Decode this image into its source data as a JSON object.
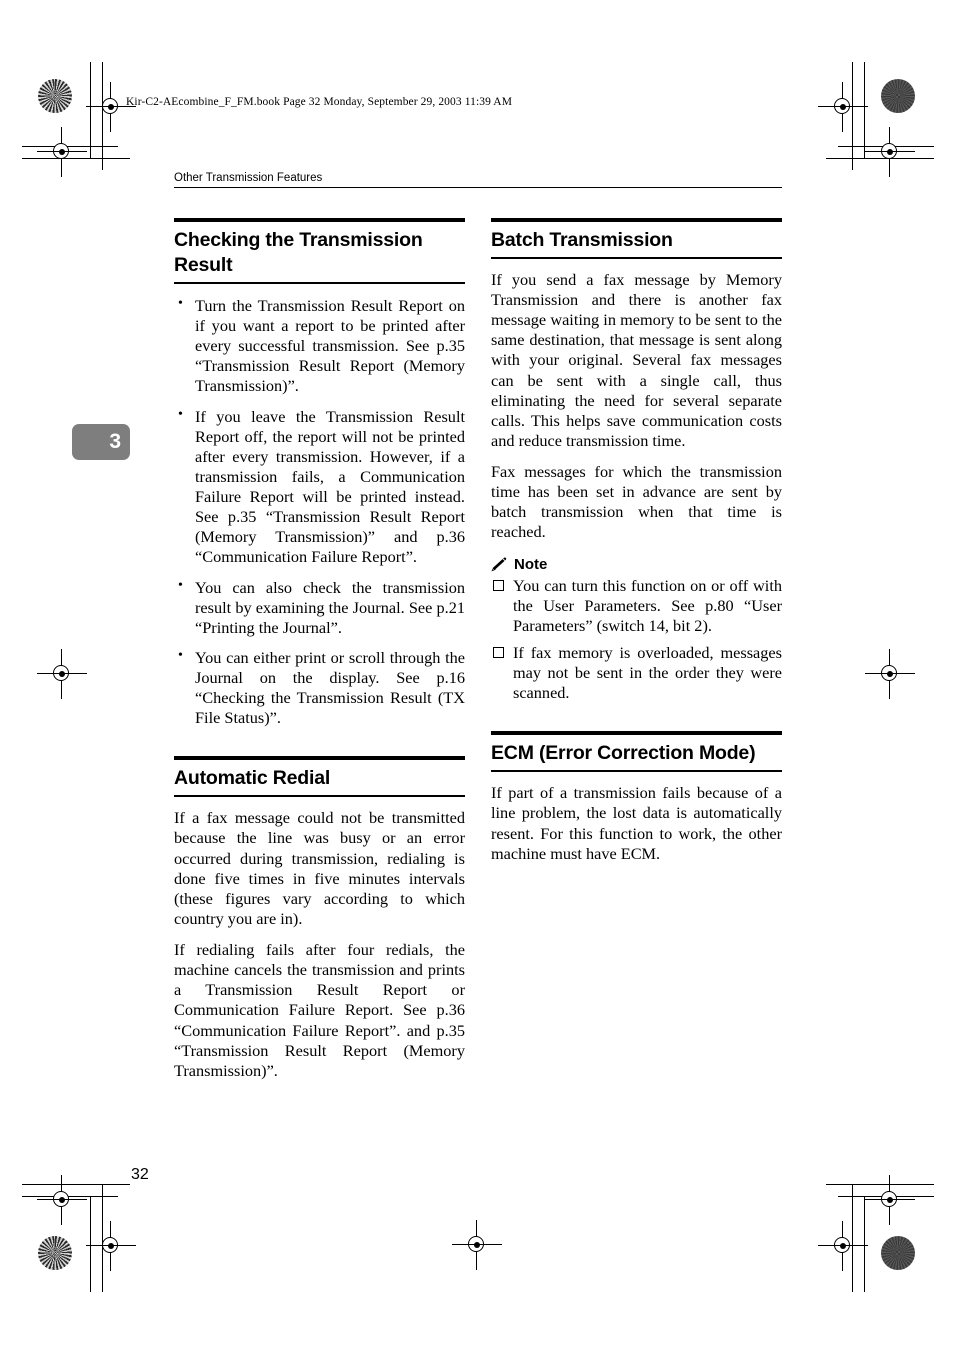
{
  "document": {
    "file_header": "Kir-C2-AEcombine_F_FM.book  Page 32  Monday, September 29, 2003  11:39 AM",
    "running_header": "Other Transmission Features",
    "chapter_tab": "3",
    "page_number": "32"
  },
  "left_column": {
    "section1": {
      "heading": "Checking the Transmission Result",
      "bullets": [
        "Turn the Transmission Result Report on if you want a report to be printed after every successful transmission. See p.35 “Transmission Result Report (Memory Transmission)”.",
        "If you leave the Transmission Result Report off, the report will not be printed after every transmission. However, if a transmission fails, a Communication Failure Report will be printed instead. See p.35 “Transmission Result Report (Memory Transmission)” and p.36 “Communication Failure Report”.",
        "You can also check the transmission result by examining the Journal. See p.21 “Printing the Journal”.",
        "You can either print or scroll through the Journal on the display. See p.16 “Checking the Transmission Result (TX File Status)”."
      ]
    },
    "section2": {
      "heading": "Automatic Redial",
      "paragraphs": [
        "If a fax message could not be transmitted because the line was busy or an error occurred during transmission, redialing is done five times in five minutes intervals (these figures vary according to which country you are in).",
        "If redialing fails after four redials, the machine cancels the transmission and prints a Transmission Result Report or Communication Failure Report. See p.36 “Communication Failure Report”. and p.35 “Transmission Result Report (Memory Transmission)”."
      ]
    }
  },
  "right_column": {
    "section1": {
      "heading": "Batch Transmission",
      "paragraphs": [
        "If you send a fax message by Memory Transmission and there is another fax message waiting in memory to be sent to the same destination, that message is sent along with your original. Several fax messages can be sent with a single call, thus eliminating the need for several separate calls. This helps save communication costs and reduce transmission time.",
        "Fax messages for which the transmission time has been set in advance are sent by batch transmission when that time is reached."
      ],
      "note": {
        "label": "Note",
        "icon": "pencil-icon",
        "items": [
          "You can turn this function on or off with the User Parameters. See p.80 “User Parameters” (switch 14, bit 2).",
          "If fax memory is overloaded, messages may not be sent in the order they were scanned."
        ]
      }
    },
    "section2": {
      "heading": "ECM (Error Correction Mode)",
      "paragraphs": [
        "If part of a transmission fails because of a line problem, the lost data is automatically resent. For this function to work, the other machine must have ECM."
      ]
    }
  },
  "colors": {
    "text": "#000000",
    "page_background": "#ffffff",
    "chapter_tab_background": "#7e7e7e",
    "chapter_tab_text": "#ffffff"
  }
}
